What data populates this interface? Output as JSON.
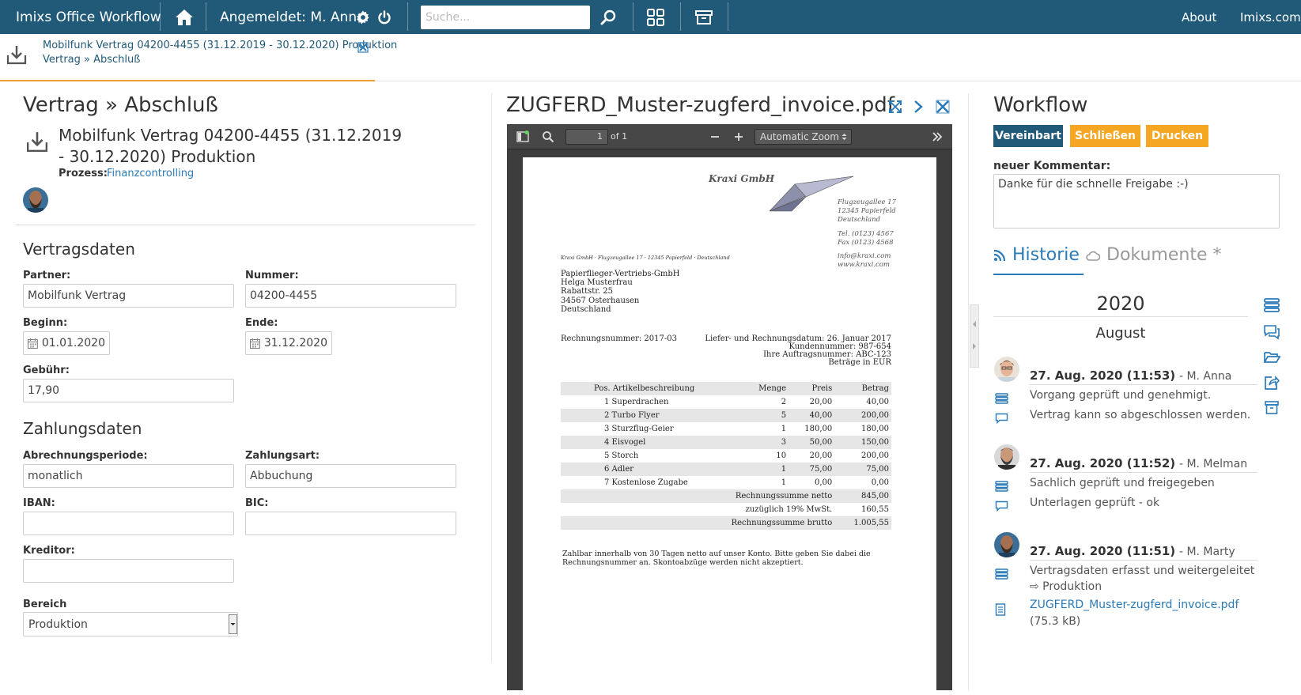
{
  "topbar": {
    "brand": "Imixs Office Workflow",
    "user_label": "Angemeldet: M. Anna",
    "search_placeholder": "Suche...",
    "links": {
      "about": "About",
      "imixs": "Imixs.com"
    },
    "colors": {
      "bar": "#215a78",
      "accent_orange": "#f0a030"
    }
  },
  "header": {
    "line1": "Mobilfunk Vertrag 04200-4455 (31.12.2019 - 30.12.2020) Produktion",
    "line2": "Vertrag » Abschluß"
  },
  "left": {
    "title": "Vertrag » Abschluß",
    "doc_title": "Mobilfunk Vertrag 04200-4455 (31.12.2019 - 30.12.2020) Produktion",
    "process_label": "Prozess:",
    "process_value": "Finanzcontrolling",
    "section_contract": "Vertragsdaten",
    "fields": {
      "partner_label": "Partner:",
      "partner_value": "Mobilfunk Vertrag",
      "number_label": "Nummer:",
      "number_value": "04200-4455",
      "begin_label": "Beginn:",
      "begin_value": "01.01.2020",
      "end_label": "Ende:",
      "end_value": "31.12.2020",
      "fee_label": "Gebühr:",
      "fee_value": "17,90"
    },
    "section_payment": "Zahlungsdaten",
    "payment": {
      "period_label": "Abrechnungsperiode:",
      "period_value": "monatlich",
      "type_label": "Zahlungsart:",
      "type_value": "Abbuchung",
      "iban_label": "IBAN:",
      "iban_value": "",
      "bic_label": "BIC:",
      "bic_value": "",
      "creditor_label": "Kreditor:",
      "creditor_value": "",
      "area_label": "Bereich",
      "area_value": "Produktion"
    }
  },
  "pdf": {
    "filename": "ZUGFERD_Muster-zugferd_invoice.pdf",
    "viewer": {
      "page": "1",
      "page_of": "of 1",
      "zoom": "Automatic Zoom"
    },
    "invoice": {
      "company": "Kraxi GmbH",
      "sender_address": [
        "Flugzeugallee 17",
        "12345 Papierfeld",
        "Deutschland"
      ],
      "phone": "Tel. (0123) 4567",
      "fax": "Fax (0123) 4568",
      "email": "info@kraxi.com",
      "web": "www.kraxi.com",
      "sender_line": "Kraxi GmbH · Flugzeugallee 17 · 12345 Papierfeld · Deutschland",
      "recipient": [
        "Papierflieger-Vertriebs-GmbH",
        "Helga Musterfrau",
        "Rabattstr. 25",
        "34567 Osterhausen",
        "Deutschland"
      ],
      "invoice_number": "Rechnungsnummer: 2017-03",
      "meta": [
        "Liefer- und Rechnungsdatum: 26. Januar 2017",
        "Kundennummer: 987-654",
        "Ihre Auftragsnummer: ABC-123",
        "Beträge in EUR"
      ],
      "table_header": [
        "Pos. Artikelbeschreibung",
        "Menge",
        "Preis",
        "Betrag"
      ],
      "items": [
        {
          "pos": "1 Superdrachen",
          "qty": "2",
          "price": "20,00",
          "amount": "40,00"
        },
        {
          "pos": "2 Turbo Flyer",
          "qty": "5",
          "price": "40,00",
          "amount": "200,00"
        },
        {
          "pos": "3 Sturzflug-Geier",
          "qty": "1",
          "price": "180,00",
          "amount": "180,00"
        },
        {
          "pos": "4 Eisvogel",
          "qty": "3",
          "price": "50,00",
          "amount": "150,00"
        },
        {
          "pos": "5 Storch",
          "qty": "10",
          "price": "20,00",
          "amount": "200,00"
        },
        {
          "pos": "6 Adler",
          "qty": "1",
          "price": "75,00",
          "amount": "75,00"
        },
        {
          "pos": "7 Kostenlose Zugabe",
          "qty": "1",
          "price": "0,00",
          "amount": "0,00"
        }
      ],
      "totals": [
        {
          "label": "Rechnungssumme netto",
          "value": "845,00"
        },
        {
          "label": "zuzüglich 19% MwSt.",
          "value": "160,55"
        },
        {
          "label": "Rechnungssumme brutto",
          "value": "1.005,55"
        }
      ],
      "payment_terms": [
        "Zahlbar innerhalb von 30 Tagen netto auf unser Konto. Bitte geben Sie dabei die",
        "Rechnungsnummer an. Skontoabzüge werden nicht akzeptiert."
      ]
    }
  },
  "workflow": {
    "title": "Workflow",
    "buttons": [
      "Vereinbart",
      "Schließen",
      "Drucken"
    ],
    "comment_label": "neuer Kommentar:",
    "comment_value": "Danke für die schnelle Freigabe :-)",
    "tabs": {
      "history": "Historie",
      "documents": "Dokumente *"
    },
    "year": "2020",
    "month": "August",
    "entries": [
      {
        "date": "27. Aug. 2020 (11:53)",
        "author": "- M. Anna",
        "lines": [
          "Vorgang geprüft und genehmigt.",
          "Vertrag kann so abgeschlossen werden."
        ]
      },
      {
        "date": "27. Aug. 2020 (11:52)",
        "author": "- M. Melman",
        "lines": [
          "Sachlich geprüft und freigegeben",
          "Unterlagen geprüft - ok"
        ]
      },
      {
        "date": "27. Aug. 2020 (11:51)",
        "author": "- M. Marty",
        "lines": [
          "Vertragsdaten erfasst und weitergeleitet",
          "⇨ Produktion"
        ],
        "attachment": "ZUGFERD_Muster-zugferd_invoice.pdf",
        "attachment_size": "(75.3 kB)"
      }
    ]
  }
}
